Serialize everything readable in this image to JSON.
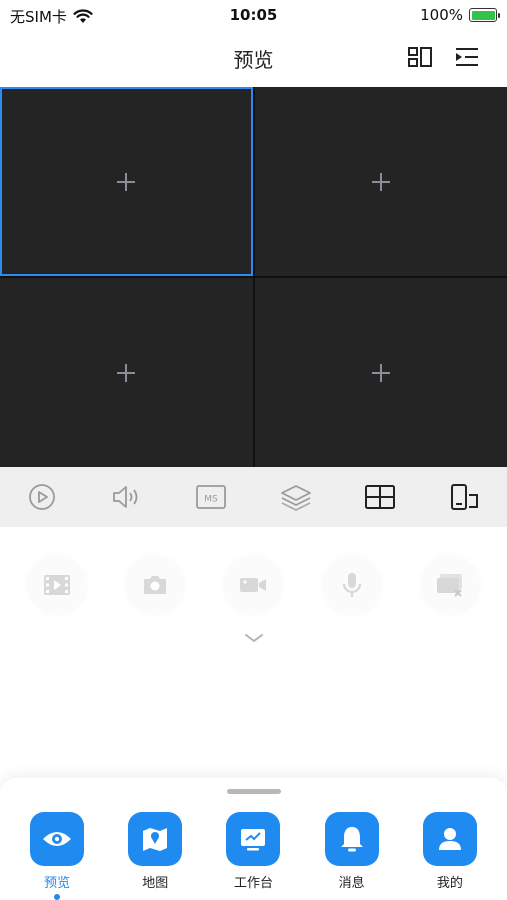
{
  "status_bar": {
    "carrier": "无SIM卡",
    "time": "10:05",
    "battery": "100%",
    "battery_level": 1.0,
    "battery_color": "#33c24d"
  },
  "header": {
    "title": "预览",
    "layout_icon": "layout-grid-icon",
    "device_list_icon": "device-list-icon"
  },
  "grid": {
    "cells": [
      {
        "icon": "add-plus-icon",
        "selected": true
      },
      {
        "icon": "add-plus-icon",
        "selected": false
      },
      {
        "icon": "add-plus-icon",
        "selected": false
      },
      {
        "icon": "add-plus-icon",
        "selected": false
      }
    ],
    "selected_border_color": "#2a8cf4"
  },
  "control_bar": {
    "icons": [
      "play-icon",
      "speaker-icon",
      "ms-icon",
      "layers-icon",
      "split-screen-icon",
      "device-switch-icon"
    ],
    "ms_text": "MS"
  },
  "actions": {
    "icons": [
      "video-playback-icon",
      "camera-icon",
      "record-icon",
      "microphone-icon",
      "close-screen-icon"
    ],
    "expand_icon": "chevron-down-icon"
  },
  "tab_bar": {
    "accent": "#1f8bf1",
    "items": [
      {
        "label": "预览",
        "icon": "eye-icon",
        "active": true
      },
      {
        "label": "地图",
        "icon": "map-icon",
        "active": false
      },
      {
        "label": "工作台",
        "icon": "workbench-icon",
        "active": false
      },
      {
        "label": "消息",
        "icon": "bell-icon",
        "active": false
      },
      {
        "label": "我的",
        "icon": "user-icon",
        "active": false
      }
    ]
  }
}
